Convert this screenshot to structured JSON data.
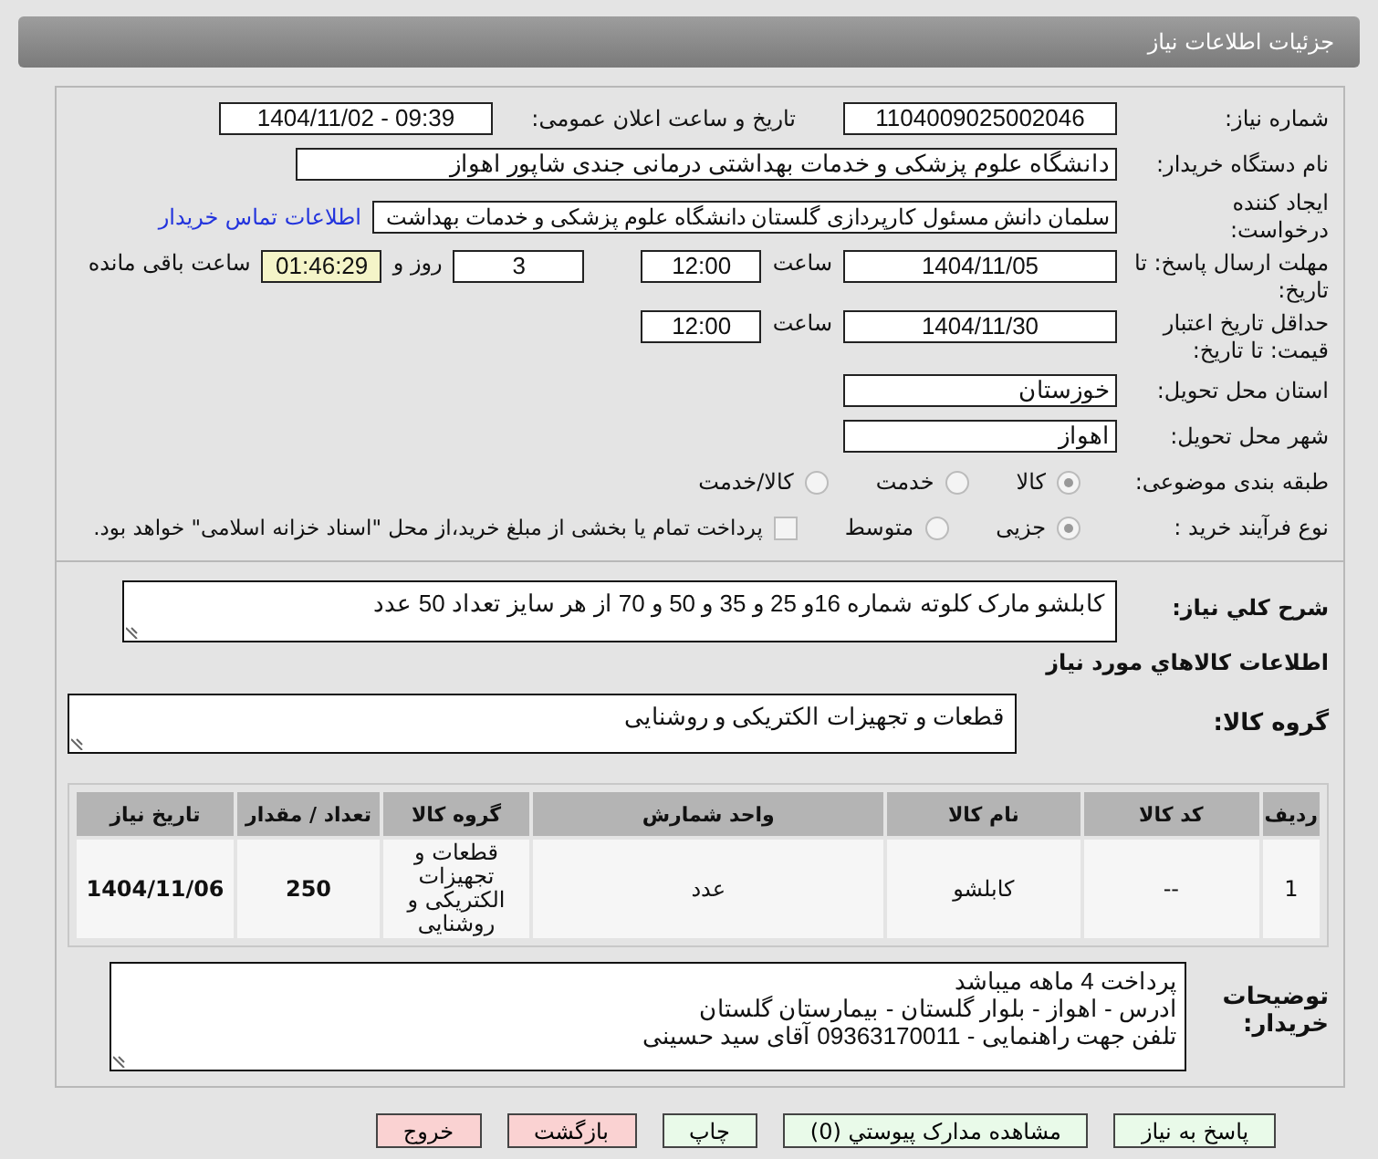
{
  "header": {
    "title": "جزئیات اطلاعات نیاز"
  },
  "form": {
    "need_number": {
      "label": "شماره نیاز:",
      "value": "1104009025002046"
    },
    "announce": {
      "label": "تاریخ و ساعت اعلان عمومی:",
      "value": "1404/11/02 - 09:39"
    },
    "buyer_org": {
      "label": "نام دستگاه خریدار:",
      "value": "دانشگاه علوم پزشکی و خدمات بهداشتی درمانی جندی شاپور اهواز"
    },
    "creator": {
      "label": "ایجاد کننده درخواست:",
      "value": "سلمان دانش مسئول کارپردازی گلستان دانشگاه علوم پزشکی و خدمات بهداشت",
      "link": "اطلاعات تماس خریدار"
    },
    "deadline": {
      "label": "مهلت ارسال پاسخ: تا تاریخ:",
      "date": "1404/11/05",
      "time_label": "ساعت",
      "time": "12:00",
      "days": "3",
      "days_label": "روز و",
      "remaining": "01:46:29",
      "remaining_label": "ساعت باقی مانده"
    },
    "validity": {
      "label": "حداقل تاریخ اعتبار قیمت: تا تاریخ:",
      "date": "1404/11/30",
      "time_label": "ساعت",
      "time": "12:00"
    },
    "province": {
      "label": "استان محل تحویل:",
      "value": "خوزستان"
    },
    "city": {
      "label": "شهر محل تحویل:",
      "value": "اهواز"
    },
    "category": {
      "label": "طبقه بندی موضوعی:",
      "options": [
        {
          "label": "کالا",
          "selected": true
        },
        {
          "label": "خدمت",
          "selected": false
        },
        {
          "label": "کالا/خدمت",
          "selected": false
        }
      ]
    },
    "process": {
      "label": "نوع فرآیند خرید :",
      "options": [
        {
          "label": "جزیی",
          "selected": true
        },
        {
          "label": "متوسط",
          "selected": false
        }
      ],
      "treasury": {
        "checked": false,
        "label": "پرداخت تمام یا بخشی از مبلغ خرید،از محل \"اسناد خزانه اسلامی\" خواهد بود."
      }
    }
  },
  "description": {
    "label": "شرح کلي نياز:",
    "value": "کابلشو مارک کلوته شماره 16و 25 و 35 و 50 و 70 از هر سایز تعداد 50 عدد"
  },
  "goods_title": "اطلاعات کالاهاي مورد نياز",
  "goods_group": {
    "label": "گروه کالا:",
    "value": "قطعات و تجهیزات الکتریکی و روشنایی"
  },
  "table": {
    "columns": [
      "ردیف",
      "کد کالا",
      "نام کالا",
      "واحد شمارش",
      "گروه کالا",
      "تعداد / مقدار",
      "تاریخ نیاز"
    ],
    "rows": [
      [
        "1",
        "--",
        "کابلشو",
        "عدد",
        "قطعات و تجهیزات الکتریکی و روشنایی",
        "250",
        "1404/11/06"
      ]
    ]
  },
  "buyer_notes": {
    "label": "توضیحات خریدار:",
    "lines": [
      "پرداخت 4 ماهه میباشد",
      "ادرس - اهواز - بلوار گلستان - بیمارستان گلستان",
      "تلفن جهت راهنمایی - 09363170011 آقای سید حسینی"
    ]
  },
  "buttons": [
    {
      "label": "پاسخ به نیاز",
      "kind": "normal"
    },
    {
      "label": "مشاهده مدارک پیوستي (0)",
      "kind": "normal"
    },
    {
      "label": "چاپ",
      "kind": "normal"
    },
    {
      "label": "بازگشت",
      "kind": "danger"
    },
    {
      "label": "خروج",
      "kind": "danger"
    }
  ]
}
